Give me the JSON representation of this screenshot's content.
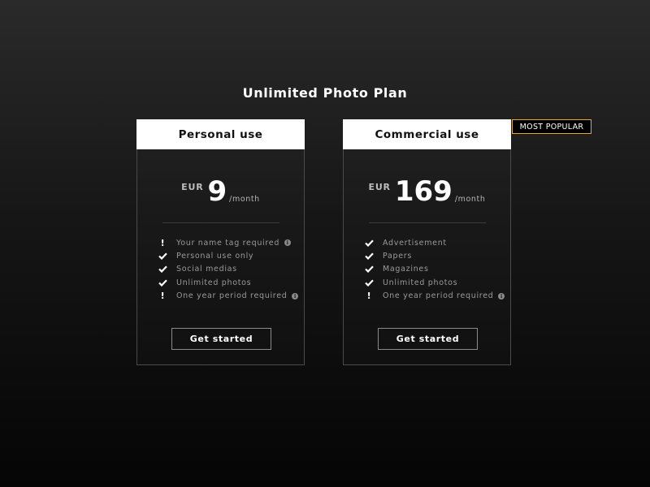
{
  "page": {
    "title": "Unlimited Photo Plan"
  },
  "badge": {
    "label": "MOST POPULAR",
    "border_color": "#e0a82e"
  },
  "plans": [
    {
      "name": "Personal use",
      "currency": "EUR",
      "amount": "9",
      "period": "/month",
      "features": [
        {
          "icon": "exclamation-icon",
          "text": "Your name tag required",
          "info": true
        },
        {
          "icon": "check-icon",
          "text": "Personal use only",
          "info": false
        },
        {
          "icon": "check-icon",
          "text": "Social medias",
          "info": false
        },
        {
          "icon": "check-icon",
          "text": "Unlimited photos",
          "info": false
        },
        {
          "icon": "exclamation-icon",
          "text": "One year period required",
          "info": true
        }
      ],
      "cta_label": "Get started"
    },
    {
      "name": "Commercial use",
      "currency": "EUR",
      "amount": "169",
      "period": "/month",
      "features": [
        {
          "icon": "check-icon",
          "text": "Advertisement",
          "info": false
        },
        {
          "icon": "check-icon",
          "text": "Papers",
          "info": false
        },
        {
          "icon": "check-icon",
          "text": "Magazines",
          "info": false
        },
        {
          "icon": "check-icon",
          "text": "Unlimited photos",
          "info": false
        },
        {
          "icon": "exclamation-icon",
          "text": "One year period required",
          "info": true
        }
      ],
      "cta_label": "Get started"
    }
  ],
  "colors": {
    "background_top": "#2a2a2a",
    "background_bottom": "#050505",
    "header_bg": "#ffffff",
    "accent": "#e0a82e"
  }
}
